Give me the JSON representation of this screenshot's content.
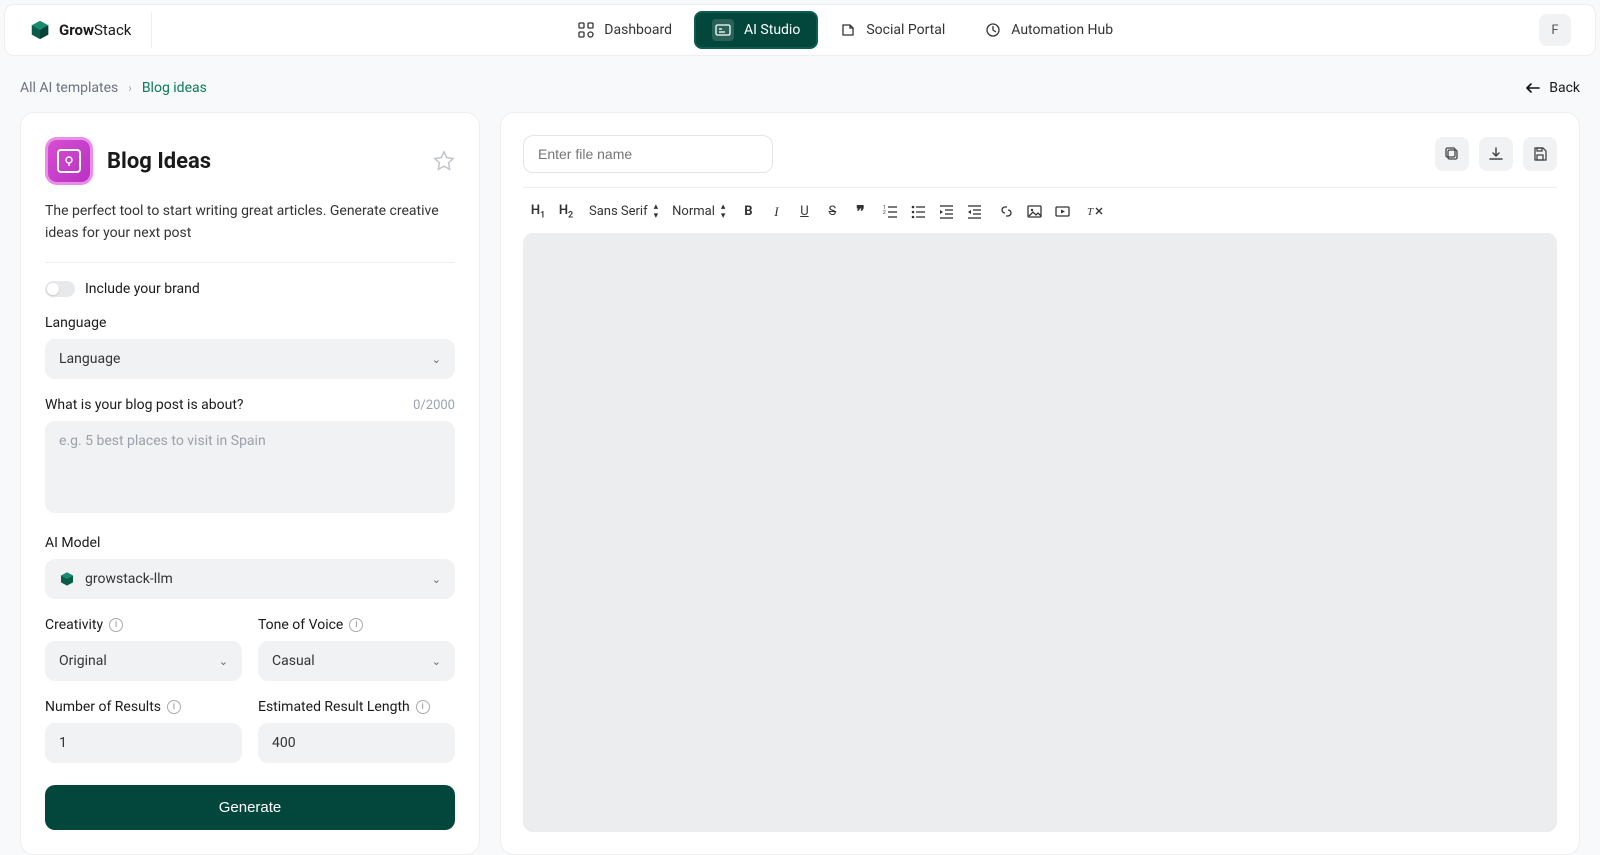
{
  "brand": {
    "name_bold": "Grow",
    "name_light": "Stack"
  },
  "nav": {
    "dashboard": "Dashboard",
    "ai_studio": "AI Studio",
    "social_portal": "Social Portal",
    "automation_hub": "Automation Hub"
  },
  "avatar_initial": "F",
  "breadcrumb": {
    "root": "All AI templates",
    "leaf": "Blog ideas"
  },
  "back_label": "Back",
  "tool": {
    "title": "Blog Ideas",
    "description": "The perfect tool to start writing great articles. Generate creative ideas for your next post"
  },
  "form": {
    "brand_toggle_label": "Include your brand",
    "language_label": "Language",
    "language_value": "Language",
    "topic_label": "What is your blog post is about?",
    "topic_counter": "0/2000",
    "topic_placeholder": "e.g. 5 best places to visit in Spain",
    "model_label": "AI Model",
    "model_value": "growstack-llm",
    "creativity_label": "Creativity",
    "creativity_value": "Original",
    "tone_label": "Tone of Voice",
    "tone_value": "Casual",
    "num_results_label": "Number of Results",
    "num_results_value": "1",
    "est_length_label": "Estimated Result Length",
    "est_length_value": "400",
    "generate_label": "Generate"
  },
  "editor": {
    "filename_placeholder": "Enter file name",
    "font_family": "Sans Serif",
    "font_size": "Normal",
    "h1": "H1",
    "h2": "H2"
  }
}
